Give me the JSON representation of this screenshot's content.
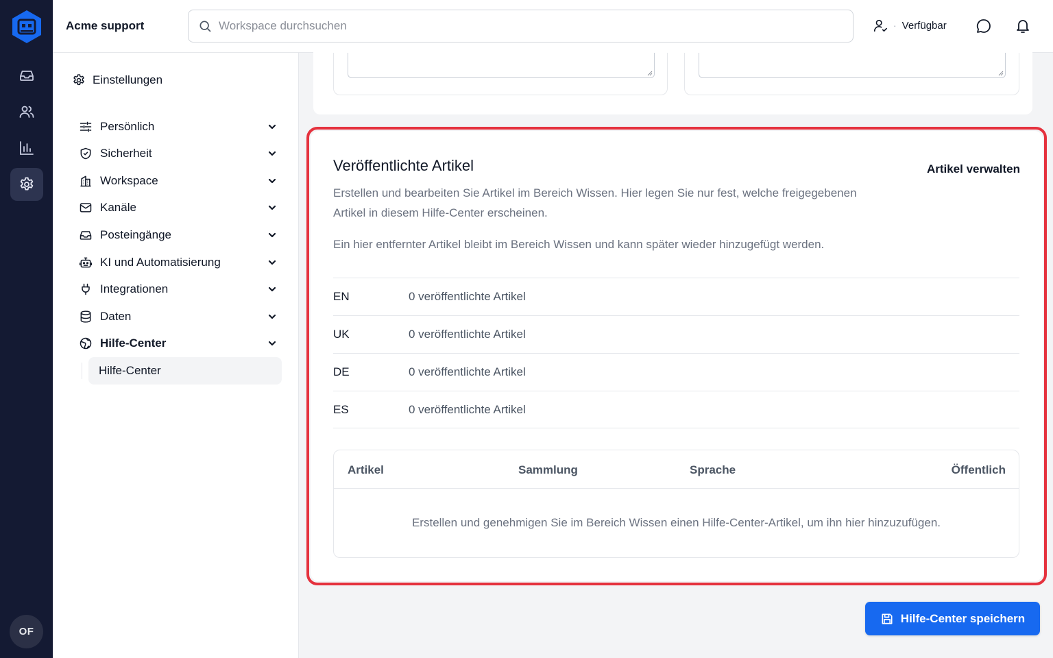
{
  "app": {
    "org_name": "Acme support",
    "user_initials": "OF"
  },
  "search": {
    "placeholder": "Workspace durchsuchen"
  },
  "status": {
    "label": "Verfügbar",
    "separator": "·"
  },
  "icons": {
    "rail": [
      "inbox-icon",
      "users-icon",
      "chart-icon",
      "gear-icon"
    ],
    "top": [
      "user-status-icon",
      "chat-bubble-icon",
      "bell-icon"
    ]
  },
  "settings": {
    "title": "Einstellungen",
    "items": [
      {
        "label": "Persönlich",
        "icon": "sliders-icon"
      },
      {
        "label": "Sicherheit",
        "icon": "shield-icon"
      },
      {
        "label": "Workspace",
        "icon": "building-icon"
      },
      {
        "label": "Kanäle",
        "icon": "mail-icon"
      },
      {
        "label": "Posteingänge",
        "icon": "inbox-icon"
      },
      {
        "label": "KI und Automatisierung",
        "icon": "bot-icon"
      },
      {
        "label": "Integrationen",
        "icon": "plug-icon"
      },
      {
        "label": "Daten",
        "icon": "database-icon"
      },
      {
        "label": "Hilfe-Center",
        "icon": "globe-icon"
      }
    ],
    "active_sub": "Hilfe-Center"
  },
  "panel": {
    "title": "Veröffentlichte Artikel",
    "manage_label": "Artikel verwalten",
    "description": "Erstellen und bearbeiten Sie Artikel im Bereich Wissen. Hier legen Sie nur fest, welche freigegebenen Artikel in diesem Hilfe-Center erscheinen.",
    "note": "Ein hier entfernter Artikel bleibt im Bereich Wissen und kann später wieder hinzugefügt werden.",
    "languages": [
      {
        "code": "EN",
        "count": "0 veröffentlichte Artikel"
      },
      {
        "code": "UK",
        "count": "0 veröffentlichte Artikel"
      },
      {
        "code": "DE",
        "count": "0 veröffentlichte Artikel"
      },
      {
        "code": "ES",
        "count": "0 veröffentlichte Artikel"
      }
    ],
    "table": {
      "columns": [
        "Artikel",
        "Sammlung",
        "Sprache",
        "Öffentlich"
      ],
      "empty": "Erstellen und genehmigen Sie im Bereich Wissen einen Hilfe-Center-Artikel, um ihn hier hinzuzufügen."
    }
  },
  "save_label": "Hilfe-Center speichern",
  "colors": {
    "rail": "#141a33",
    "accent": "#1769f0",
    "highlight": "#e5323e"
  }
}
